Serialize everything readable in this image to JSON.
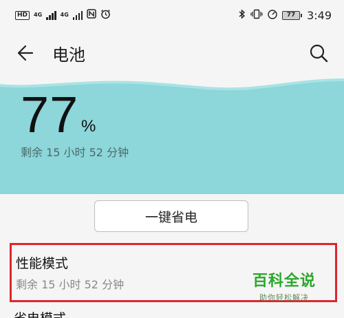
{
  "status_bar": {
    "hd": "HD",
    "net1": "4G",
    "net2": "4G",
    "nfc_icon": "nfc-icon",
    "alarm_icon": "alarm-icon",
    "bluetooth_icon": "bluetooth-icon",
    "vibrate_icon": "vibrate-icon",
    "battery_percent": "77",
    "time": "3:49"
  },
  "header": {
    "title": "电池",
    "back_icon": "back-arrow-icon",
    "search_icon": "search-icon"
  },
  "battery": {
    "percent": "77",
    "unit": "%",
    "remaining": "剩余 15 小时 52 分钟",
    "panel_color": "#8dd6d9"
  },
  "actions": {
    "one_key_save": "一键省电"
  },
  "performance_mode": {
    "title": "性能模式",
    "subtitle": "剩余 15 小时 52 分钟",
    "highlight_color": "#e0242d"
  },
  "watermark": {
    "main": "百科全说",
    "sub": "助你轻松解决"
  },
  "next_row": {
    "title": "省电模式"
  }
}
